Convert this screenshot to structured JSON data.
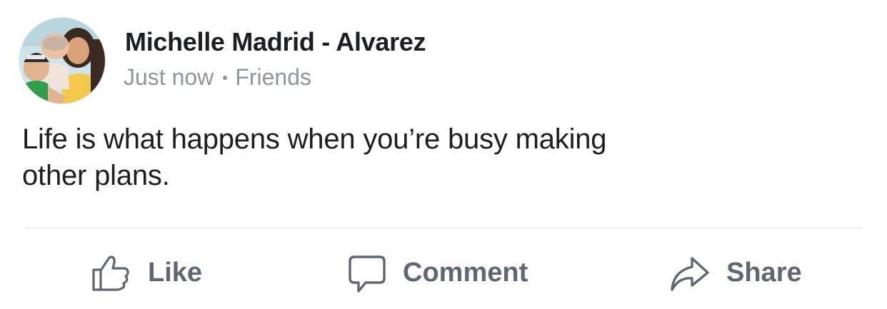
{
  "post": {
    "author": "Michelle Madrid - Alvarez",
    "timestamp": "Just now",
    "separator_icon": "dot",
    "audience": "Friends",
    "text_line1": "Life is what happens when you’re busy making",
    "text_line2": "other plans."
  },
  "actions": {
    "like": {
      "label": "Like",
      "icon": "thumbs-up-icon"
    },
    "comment": {
      "label": "Comment",
      "icon": "speech-bubble-icon"
    },
    "share": {
      "label": "Share",
      "icon": "share-arrow-icon"
    }
  },
  "colors": {
    "author_text": "#1c1e21",
    "meta_text": "#90949c",
    "action_text": "#606770",
    "divider": "#dadde1",
    "background": "#ffffff"
  }
}
